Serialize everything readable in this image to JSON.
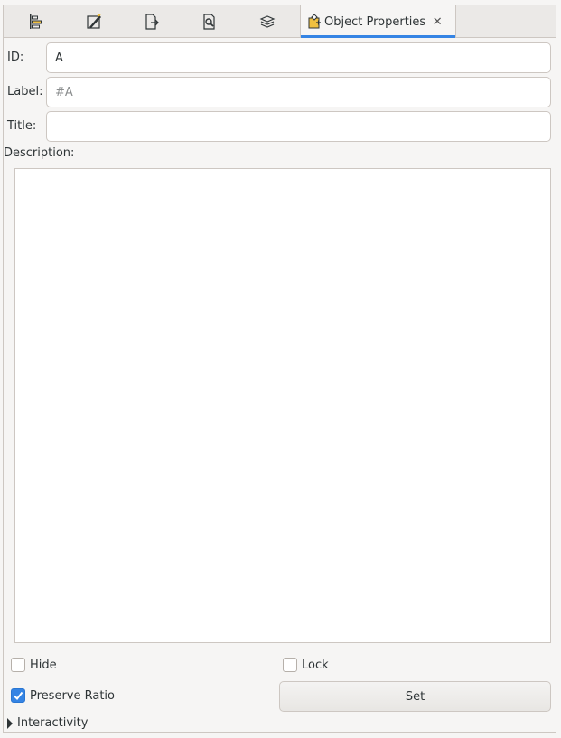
{
  "tabs": [
    {
      "icon": "align-distribute-icon"
    },
    {
      "icon": "fill-stroke-icon"
    },
    {
      "icon": "export-icon"
    },
    {
      "icon": "find-replace-icon"
    },
    {
      "icon": "layers-icon"
    }
  ],
  "active_tab": {
    "icon": "object-properties-icon",
    "label": "Object Properties",
    "close_glyph": "✕"
  },
  "form": {
    "id_label": "ID:",
    "id_value": "A",
    "label_label": "Label:",
    "label_placeholder": "#A",
    "title_label": "Title:",
    "title_value": "",
    "description_label": "Description:",
    "description_value": ""
  },
  "options": {
    "hide_label": "Hide",
    "hide_checked": false,
    "lock_label": "Lock",
    "lock_checked": false,
    "preserve_ratio_label": "Preserve Ratio",
    "preserve_ratio_checked": true,
    "set_button": "Set",
    "interactivity_label": "Interactivity"
  },
  "colors": {
    "accent": "#3584e4"
  }
}
